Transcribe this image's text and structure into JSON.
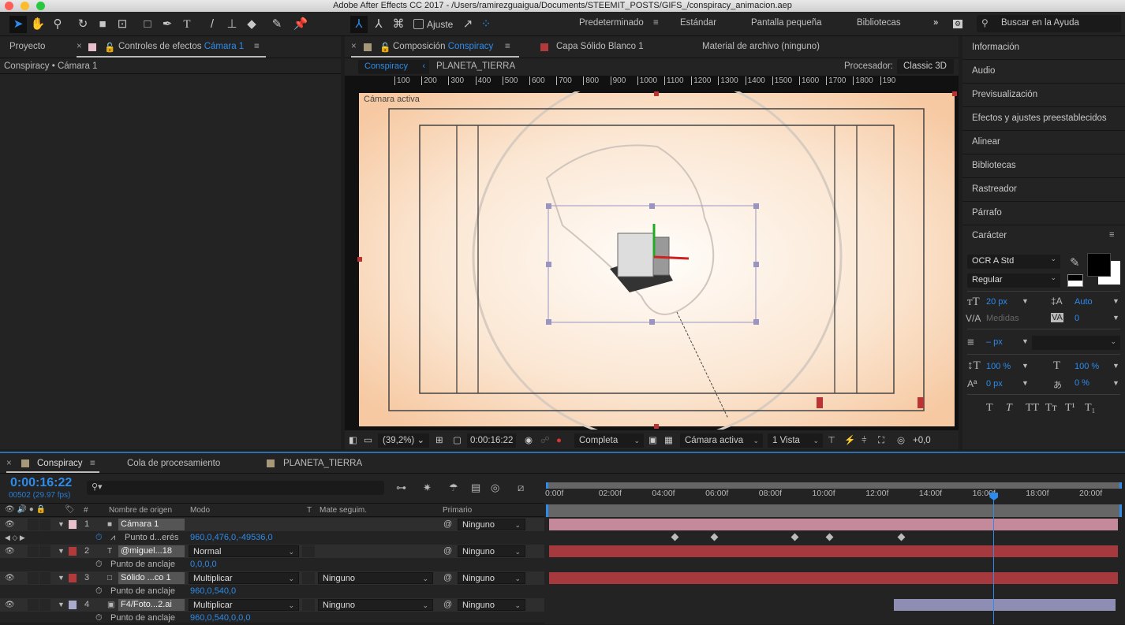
{
  "window": {
    "title": "Adobe After Effects CC 2017 - /Users/ramirezguaigua/Documents/STEEMIT_POSTS/GIFS_/conspiracy_animacion.aep"
  },
  "toolbar": {
    "tools": [
      "selection-tool",
      "hand-tool",
      "zoom-tool",
      "rotate-tool",
      "camera-tool",
      "pan-behind-tool",
      "rectangle-tool",
      "pen-tool",
      "type-tool",
      "brush-tool",
      "clone-stamp-tool",
      "eraser-tool",
      "roto-brush-tool",
      "puppet-pin-tool"
    ],
    "snap_label": "Ajuste",
    "workspaces": [
      "Predeterminado",
      "Estándar",
      "Pantalla pequeña",
      "Bibliotecas"
    ],
    "active_workspace": "Predeterminado",
    "search_placeholder": "Buscar en la Ayuda"
  },
  "left_panel": {
    "tab_project": "Proyecto",
    "tab_effects": "Controles de efectos",
    "tab_effects_layer": "Cámara 1",
    "breadcrumb": "Conspiracy • Cámara 1"
  },
  "comp_panel": {
    "tab_comp": "Composición",
    "tab_comp_name": "Conspiracy",
    "tab_layer": "Capa Sólido Blanco 1",
    "tab_footage": "Material de archivo (ninguno)",
    "nav": [
      "Conspiracy",
      "PLANETA_TIERRA"
    ],
    "renderer_label": "Procesador:",
    "renderer": "Classic 3D",
    "ruler_ticks": [
      "100",
      "200",
      "300",
      "400",
      "500",
      "600",
      "700",
      "800",
      "900",
      "1000",
      "1100",
      "1200",
      "1300",
      "1400",
      "1500",
      "1600",
      "1700",
      "1800",
      "190"
    ],
    "view_label": "Cámara activa",
    "zoom": "(39,2%)",
    "timecode": "0:00:16:22",
    "resolution": "Completa",
    "camera": "Cámara activa",
    "views": "1 Vista",
    "exposure": "+0,0"
  },
  "right_panel": {
    "items": [
      "Información",
      "Audio",
      "Previsualización",
      "Efectos y ajustes preestablecidos",
      "Alinear",
      "Bibliotecas",
      "Rastreador",
      "Párrafo"
    ],
    "character": {
      "title": "Carácter",
      "font": "OCR A Std",
      "style": "Regular",
      "size": "20 px",
      "leading": "Auto",
      "kerning": "Medidas",
      "tracking": "0",
      "stroke": "– px",
      "vscale": "100 %",
      "hscale": "100 %",
      "baseline": "0 px",
      "tsume": "0 %",
      "styles": [
        "T",
        "T",
        "TT",
        "Tт",
        "T¹",
        "T₁"
      ]
    }
  },
  "timeline": {
    "tabs": [
      "Conspiracy",
      "Cola de procesamiento",
      "PLANETA_TIERRA"
    ],
    "timecode": "0:00:16:22",
    "frame_info": "00502 (29.97 fps)",
    "columns": {
      "num": "#",
      "source": "Nombre de origen",
      "mode": "Modo",
      "t": "T",
      "matte": "Mate seguim.",
      "parent": "Primario"
    },
    "time_labels": [
      "0:00f",
      "02:00f",
      "04:00f",
      "06:00f",
      "08:00f",
      "10:00f",
      "12:00f",
      "14:00f",
      "16:00f",
      "18:00f",
      "20:00f"
    ],
    "current_time_seconds": 16.73,
    "layers": [
      {
        "num": "1",
        "name": "Cámara 1",
        "label_color": "#e8c0cc",
        "mode": "",
        "matte": "",
        "parent": "Ninguno",
        "prop": "Punto d...erés",
        "value": "960,0,476,0,-49536,0",
        "bar_color": "#c48a9c",
        "bar_start": 0,
        "bar_end": 21.3,
        "keyframes": [
          4.6,
          6.1,
          9.1,
          10.4,
          13.1
        ]
      },
      {
        "num": "2",
        "name": "@miguel...18",
        "label_color": "#b23a3a",
        "mode": "Normal",
        "matte": "",
        "parent": "Ninguno",
        "prop": "Punto de anclaje",
        "value": "0,0,0,0",
        "bar_color": "#a5393d",
        "bar_start": 0,
        "bar_end": 21.3
      },
      {
        "num": "3",
        "name": "Sólido ...co 1",
        "label_color": "#b23a3a",
        "mode": "Multiplicar",
        "matte": "Ninguno",
        "parent": "Ninguno",
        "prop": "Punto de anclaje",
        "value": "960,0,540,0",
        "bar_color": "#a5393d",
        "bar_start": 0,
        "bar_end": 21.3
      },
      {
        "num": "4",
        "name": "F4/Foto...2.ai",
        "label_color": "#a9a9cc",
        "mode": "Multiplicar",
        "matte": "Ninguno",
        "parent": "Ninguno",
        "prop": "Punto de anclaje",
        "value": "960,0,540,0,0,0",
        "bar_color": "#8e8eb4",
        "bar_start": 12.9,
        "bar_end": 21.2
      }
    ]
  }
}
